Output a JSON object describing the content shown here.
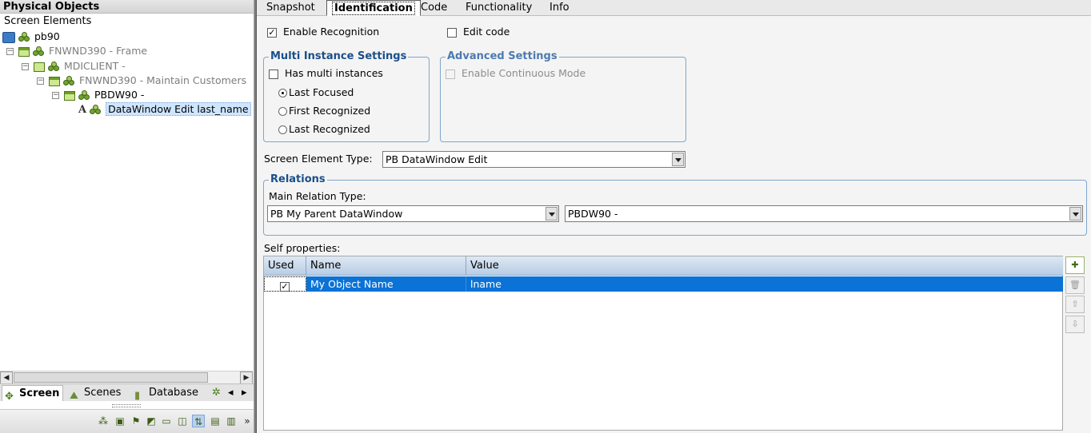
{
  "left_panel": {
    "title": "Physical Objects",
    "section": "Screen Elements",
    "tree": [
      {
        "label": "pb90",
        "level": 0,
        "icon": "application-icon"
      },
      {
        "label": "FNWND390 - Frame",
        "level": 1,
        "icon": "frame-icon"
      },
      {
        "label": "MDICLIENT -",
        "level": 2,
        "icon": "window-icon"
      },
      {
        "label": "FNWND390 - Maintain Customers",
        "level": 3,
        "icon": "frame-icon"
      },
      {
        "label": "PBDW90 -",
        "level": 4,
        "icon": "frame-icon"
      },
      {
        "label": "DataWindow Edit last_name",
        "level": 5,
        "icon": "edit-icon",
        "selected": true
      }
    ],
    "bottom_tabs": [
      "Screen",
      "Scenes",
      "Database"
    ],
    "active_bottom_tab": "Screen"
  },
  "tabs": [
    "Snapshot",
    "Identification",
    "Code",
    "Functionality",
    "Info"
  ],
  "active_tab": "Identification",
  "identification": {
    "enable_recognition": {
      "label": "Enable Recognition",
      "checked": true
    },
    "edit_code": {
      "label": "Edit code",
      "checked": false
    },
    "multi_instance": {
      "title": "Multi Instance Settings",
      "has_multi": {
        "label": "Has multi instances",
        "checked": false
      },
      "options": [
        "Last Focused",
        "First Recognized",
        "Last Recognized"
      ],
      "selected": "Last Focused"
    },
    "advanced": {
      "title": "Advanced Settings",
      "continuous": {
        "label": "Enable Continuous Mode",
        "checked": false,
        "enabled": false
      }
    },
    "screen_element_type": {
      "label": "Screen Element Type:",
      "value": "PB DataWindow Edit"
    },
    "relations": {
      "title": "Relations",
      "main_label": "Main Relation Type:",
      "type_value": "PB My Parent DataWindow",
      "target_value": "PBDW90 -"
    },
    "self_properties": {
      "label": "Self properties:",
      "columns": [
        "Used",
        "Name",
        "Value"
      ],
      "rows": [
        {
          "used": true,
          "name": "My Object Name",
          "value": "lname"
        }
      ]
    }
  },
  "colors": {
    "selection_blue": "#0b72d6",
    "group_border": "#7ea6cf",
    "group_title": "#1b4f8a"
  }
}
